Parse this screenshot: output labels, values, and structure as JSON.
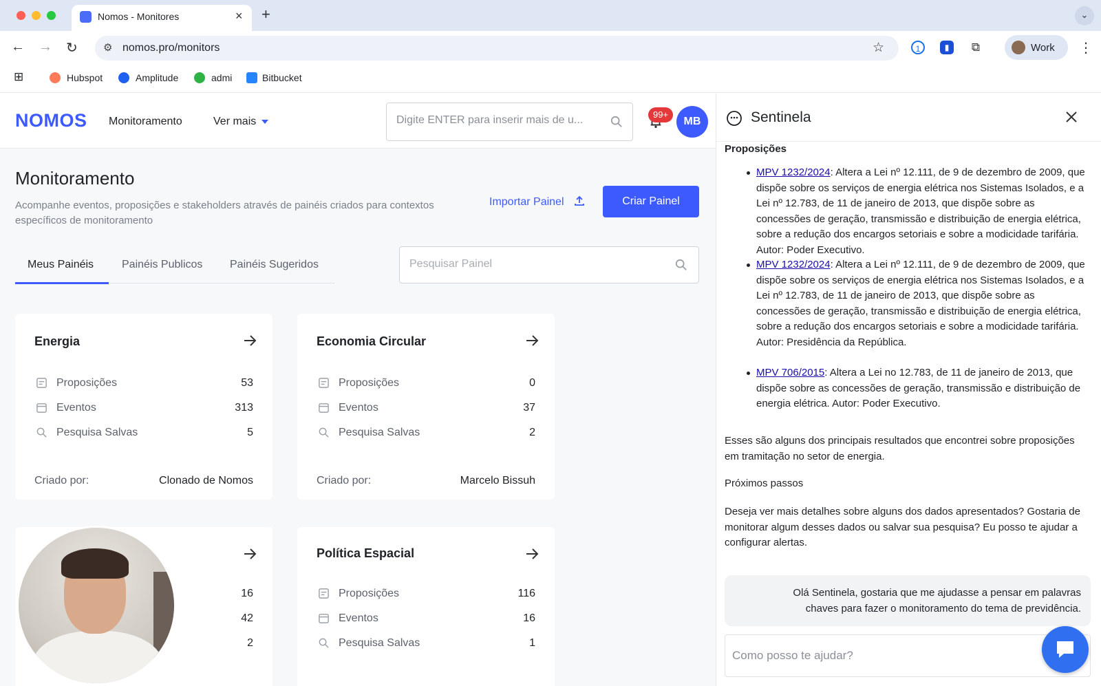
{
  "browser": {
    "tab_title": "Nomos - Monitores",
    "url": "nomos.pro/monitors",
    "profile_label": "Work",
    "bookmarks": [
      {
        "label": "Hubspot",
        "color": "#ff7a59"
      },
      {
        "label": "Amplitude",
        "color": "#1e61f0"
      },
      {
        "label": "admi",
        "color": "#2fb344"
      },
      {
        "label": "Bitbucket",
        "color": "#2684ff"
      }
    ]
  },
  "header": {
    "logo": "NOMOS",
    "nav_monitoramento": "Monitoramento",
    "nav_ver_mais": "Ver mais",
    "search_placeholder": "Digite ENTER para inserir mais de u...",
    "notifications_badge": "99+",
    "avatar_initials": "MB"
  },
  "page": {
    "title": "Monitoramento",
    "subtitle": "Acompanhe eventos, proposições e stakeholders através de painéis criados para contextos específicos de monitoramento",
    "import_label": "Importar Painel",
    "create_label": "Criar Painel",
    "tabs": [
      "Meus Painéis",
      "Painéis Publicos",
      "Painéis Sugeridos"
    ],
    "panel_search_placeholder": "Pesquisar Painel"
  },
  "cards": [
    {
      "title": "Energia",
      "rows": [
        {
          "label": "Proposições",
          "value": "53"
        },
        {
          "label": "Eventos",
          "value": "313"
        },
        {
          "label": "Pesquisa Salvas",
          "value": "5"
        }
      ],
      "created_by_label": "Criado por:",
      "created_by": "Clonado de Nomos"
    },
    {
      "title": "Economia Circular",
      "rows": [
        {
          "label": "Proposições",
          "value": "0"
        },
        {
          "label": "Eventos",
          "value": "37"
        },
        {
          "label": "Pesquisa Salvas",
          "value": "2"
        }
      ],
      "created_by_label": "Criado por:",
      "created_by": "Marcelo Bissuh"
    },
    {
      "title": "",
      "rows": [
        {
          "label": "",
          "value": "16"
        },
        {
          "label": "",
          "value": "42"
        },
        {
          "label": "",
          "value": "2"
        }
      ]
    },
    {
      "title": "Política Espacial",
      "rows": [
        {
          "label": "Proposições",
          "value": "116"
        },
        {
          "label": "Eventos",
          "value": "16"
        },
        {
          "label": "Pesquisa Salvas",
          "value": "1"
        }
      ]
    }
  ],
  "sentinela": {
    "title": "Sentinela",
    "section": "Proposições",
    "items": [
      {
        "link": "MPV 1232/2024",
        "text": ": Altera a Lei nº 12.111, de 9 de dezembro de 2009, que dispõe sobre os serviços de energia elétrica nos Sistemas Isolados, e a Lei nº 12.783, de 11 de janeiro de 2013, que dispõe sobre as concessões de geração, transmissão e distribuição de energia elétrica, sobre a redução dos encargos setoriais e sobre a modicidade tarifária. Autor: Poder Executivo."
      },
      {
        "link": "MPV 1232/2024",
        "text": ": Altera a Lei nº 12.111, de 9 de dezembro de 2009, que dispõe sobre os serviços de energia elétrica nos Sistemas Isolados, e a Lei nº 12.783, de 11 de janeiro de 2013, que dispõe sobre as concessões de geração, transmissão e distribuição de energia elétrica, sobre a redução dos encargos setoriais e sobre a modicidade tarifária. Autor: Presidência da República."
      },
      {
        "link": "MPV 706/2015",
        "text": ": Altera a Lei no 12.783, de 11 de janeiro de 2013, que dispõe sobre as concessões de geração, transmissão e distribuição de energia elétrica. Autor: Poder Executivo."
      }
    ],
    "summary": "Esses são alguns dos principais resultados que encontrei sobre proposições em tramitação no setor de energia.",
    "next_steps": "Próximos passos",
    "question": "Deseja ver mais detalhes sobre alguns dos dados apresentados? Gostaria de monitorar algum desses dados ou salvar sua pesquisa? Eu posso te ajudar a configurar alertas.",
    "user_message": "Olá Sentinela, gostaria que me ajudasse a pensar em palavras chaves para fazer o monitoramento do tema de previdência.",
    "input_placeholder": "Como posso te ajudar?"
  }
}
